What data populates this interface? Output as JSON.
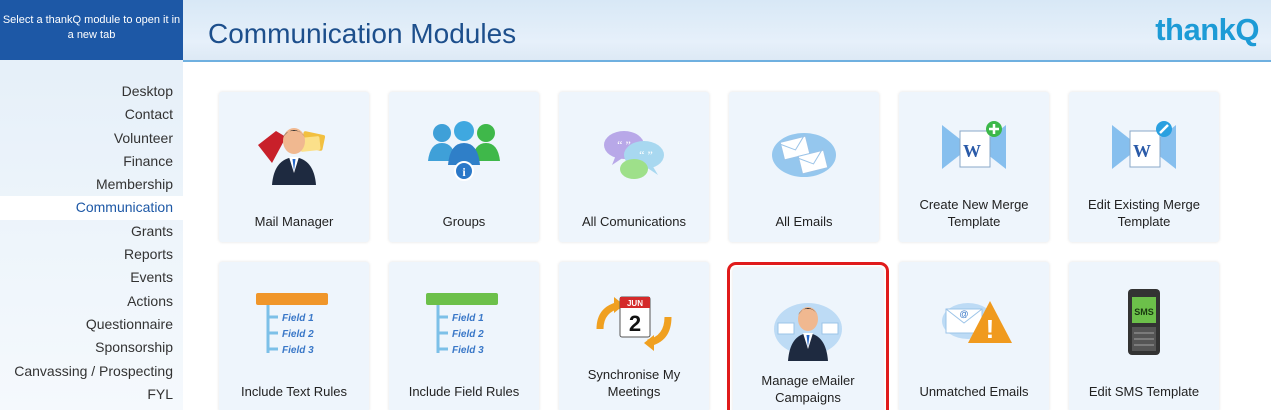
{
  "sidebar": {
    "header": "Select a thankQ module to open it in a new tab",
    "items": [
      {
        "label": "Desktop"
      },
      {
        "label": "Contact"
      },
      {
        "label": "Volunteer"
      },
      {
        "label": "Finance"
      },
      {
        "label": "Membership"
      },
      {
        "label": "Communication",
        "active": true
      },
      {
        "label": "Grants"
      },
      {
        "label": "Reports"
      },
      {
        "label": "Events"
      },
      {
        "label": "Actions"
      },
      {
        "label": "Questionnaire"
      },
      {
        "label": "Sponsorship"
      },
      {
        "label": "Canvassing / Prospecting"
      },
      {
        "label": "FYL"
      }
    ]
  },
  "header": {
    "title": "Communication Modules",
    "logo_text": "thank",
    "logo_q": "Q"
  },
  "tiles": [
    {
      "label": "Mail Manager",
      "icon": "mail-manager-icon"
    },
    {
      "label": "Groups",
      "icon": "groups-icon"
    },
    {
      "label": "All Comunications",
      "icon": "chat-bubbles-icon"
    },
    {
      "label": "All Emails",
      "icon": "envelopes-icon"
    },
    {
      "label": "Create New Merge Template",
      "icon": "word-add-icon"
    },
    {
      "label": "Edit Existing Merge Template",
      "icon": "word-edit-icon"
    },
    {
      "label": "Include Text Rules",
      "icon": "text-rules-icon"
    },
    {
      "label": "Include Field Rules",
      "icon": "field-rules-icon"
    },
    {
      "label": "Synchronise My Meetings",
      "icon": "calendar-sync-icon"
    },
    {
      "label": "Manage eMailer Campaigns",
      "icon": "emailer-person-icon",
      "highlighted": true
    },
    {
      "label": "Unmatched Emails",
      "icon": "email-warning-icon"
    },
    {
      "label": "Edit SMS Template",
      "icon": "sms-phone-icon"
    }
  ],
  "rule_icon_text": {
    "field1": "Field 1",
    "field2": "Field 2",
    "field3": "Field 3"
  },
  "calendar_text": {
    "month": "JUN",
    "day": "2"
  },
  "sms_text": "SMS",
  "colors": {
    "header_blue": "#1d58a6",
    "title_blue": "#1d4f8c",
    "logo_blue": "#1d9bd6",
    "highlight_red": "#e01b1b",
    "tile_bg": "#eef5fc"
  }
}
